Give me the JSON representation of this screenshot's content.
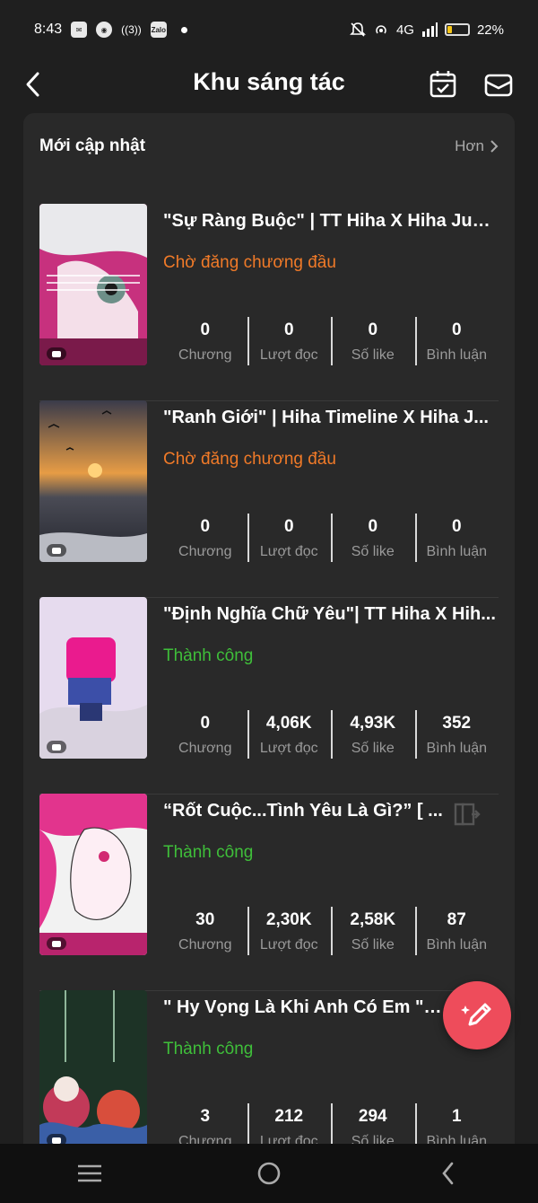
{
  "status_bar": {
    "time": "8:43",
    "network": "4G",
    "battery": "22%",
    "battery_level": 0.22,
    "icons": [
      "mail-notification-icon",
      "globe-icon",
      "signal-3-icon",
      "zalo-icon",
      "dot-icon",
      "mute-icon",
      "hotspot-icon",
      "signal-bars-icon",
      "battery-icon"
    ],
    "zalo_label": "Zalo",
    "signal_label": "((3))"
  },
  "header": {
    "title": "Khu sáng tác"
  },
  "section": {
    "title": "Mới cập nhật",
    "more_label": "Hơn"
  },
  "stat_labels": {
    "chapters": "Chương",
    "reads": "Lượt đọc",
    "likes": "Số like",
    "comments": "Bình luận"
  },
  "stories": [
    {
      "title": "\"Sự Ràng Buộc\" | TT Hiha X Hiha Jud...",
      "status": "Chờ đăng chương đầu",
      "status_kind": "pending",
      "chapters": "0",
      "reads": "0",
      "likes": "0",
      "comments": "0",
      "cover_colors": [
        "#d63b8a",
        "#f7f0f3"
      ]
    },
    {
      "title": "\"Ranh Giới\" | Hiha Timeline X Hiha J...",
      "status": "Chờ đăng chương đầu",
      "status_kind": "pending",
      "chapters": "0",
      "reads": "0",
      "likes": "0",
      "comments": "0",
      "cover_colors": [
        "#c98a3a",
        "#2b2b3a"
      ]
    },
    {
      "title": "\"Định Nghĩa Chữ Yêu\"| TT Hiha X Hih...",
      "status": "Thành công",
      "status_kind": "ok",
      "chapters": "0",
      "reads": "4,06K",
      "likes": "4,93K",
      "comments": "352",
      "cover_colors": [
        "#e9dcef",
        "#e0198c"
      ]
    },
    {
      "title": "“Rốt Cuộc...Tình Yêu Là Gì?” [ ...",
      "status": "Thành công",
      "status_kind": "ok",
      "chapters": "30",
      "reads": "2,30K",
      "likes": "2,58K",
      "comments": "87",
      "cover_colors": [
        "#e8378f",
        "#f4f4f4"
      ]
    },
    {
      "title": "\" Hy Vọng Là Khi Anh Có Em \" | ...",
      "status": "Thành công",
      "status_kind": "ok",
      "chapters": "3",
      "reads": "212",
      "likes": "294",
      "comments": "1",
      "cover_colors": [
        "#1f3a2a",
        "#d9455a"
      ]
    }
  ],
  "colors": {
    "background": "#1f1f1f",
    "panel": "#292929",
    "pending": "#f07a28",
    "success": "#3fbf3a",
    "fab": "#ee4c5b"
  }
}
